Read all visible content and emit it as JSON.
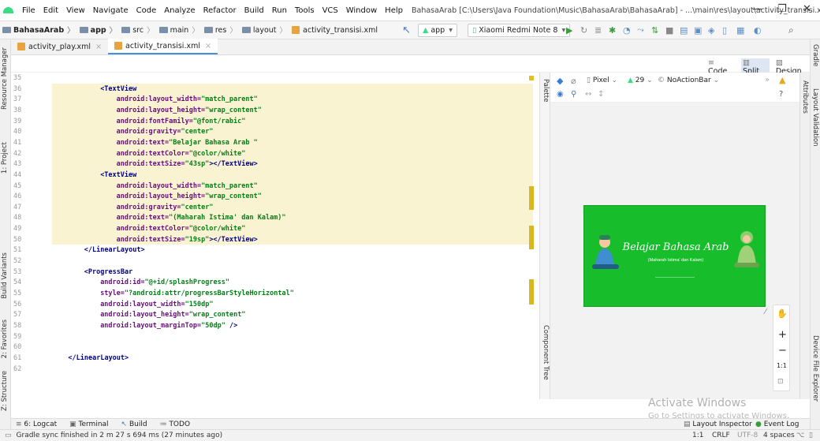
{
  "menu": {
    "items": [
      "File",
      "Edit",
      "View",
      "Navigate",
      "Code",
      "Analyze",
      "Refactor",
      "Build",
      "Run",
      "Tools",
      "VCS",
      "Window",
      "Help"
    ],
    "window_title": "BahasaArab [C:\\Users\\Java Foundation\\Music\\BahasaArab\\BahasaArab] - ...\\main\\res\\layout\\activity_transisi.xml [app]"
  },
  "nav": {
    "breadcrumbs": [
      "BahasaArab",
      "app",
      "src",
      "main",
      "res",
      "layout",
      "activity_transisi.xml"
    ],
    "module": "app",
    "device": "Xiaomi Redmi Note 8"
  },
  "tabs": [
    {
      "label": "activity_play.xml",
      "active": false
    },
    {
      "label": "activity_transisi.xml",
      "active": true
    }
  ],
  "view_modes": {
    "code": "Code",
    "split": "Split",
    "design": "Design"
  },
  "design_toolbar": {
    "device": "Pixel",
    "api": "29",
    "theme": "NoActionBar"
  },
  "left_tools": [
    "Resource Manager",
    "1: Project",
    "Build Variants",
    "2: Favorites",
    "Z: Structure"
  ],
  "right_tools": [
    "Gradle",
    "Layout Validation",
    "Device File Explorer"
  ],
  "attributes_label": "Attributes",
  "palette_label": "Palette",
  "component_tree_label": "Component Tree",
  "line_numbers": [
    "35",
    "36",
    "37",
    "38",
    "39",
    "40",
    "41",
    "42",
    "43",
    "44",
    "45",
    "46",
    "47",
    "48",
    "49",
    "50",
    "51",
    "52",
    "53",
    "54",
    "55",
    "56",
    "57",
    "58",
    "59",
    "60",
    "61",
    "62"
  ],
  "code": [
    {
      "parts": []
    },
    {
      "parts": [
        [
          "tag",
          "<TextView"
        ]
      ]
    },
    {
      "parts": [
        [
          "attr",
          "android:layout_width="
        ],
        [
          "val",
          "\"match_parent\""
        ]
      ]
    },
    {
      "parts": [
        [
          "attr",
          "android:layout_height="
        ],
        [
          "val",
          "\"wrap_content\""
        ]
      ]
    },
    {
      "parts": [
        [
          "attr",
          "android:fontFamily="
        ],
        [
          "val",
          "\"@font/rabic\""
        ]
      ]
    },
    {
      "parts": [
        [
          "attr",
          "android:gravity="
        ],
        [
          "val",
          "\"center\""
        ]
      ]
    },
    {
      "parts": [
        [
          "attr",
          "android:text="
        ],
        [
          "val",
          "\"Belajar Bahasa Arab \""
        ]
      ]
    },
    {
      "parts": [
        [
          "attr",
          "android:textColor="
        ],
        [
          "val",
          "\"@color/white\""
        ]
      ]
    },
    {
      "parts": [
        [
          "attr",
          "android:textSize="
        ],
        [
          "val",
          "\"43sp\""
        ],
        [
          "tag",
          "></TextView>"
        ]
      ]
    },
    {
      "parts": [
        [
          "tag",
          "<TextView"
        ]
      ]
    },
    {
      "parts": [
        [
          "attr",
          "android:layout_width="
        ],
        [
          "val",
          "\"match_parent\""
        ]
      ]
    },
    {
      "parts": [
        [
          "attr",
          "android:layout_height="
        ],
        [
          "val",
          "\"wrap_content\""
        ]
      ]
    },
    {
      "parts": [
        [
          "attr",
          "android:gravity="
        ],
        [
          "val",
          "\"center\""
        ]
      ]
    },
    {
      "parts": [
        [
          "attr",
          "android:text="
        ],
        [
          "val",
          "\"(Maharah Istima' dan Kalam)\""
        ]
      ]
    },
    {
      "parts": [
        [
          "attr",
          "android:textColor="
        ],
        [
          "val",
          "\"@color/white\""
        ]
      ]
    },
    {
      "parts": [
        [
          "attr",
          "android:textSize="
        ],
        [
          "val",
          "\"19sp\""
        ],
        [
          "tag",
          "></TextView>"
        ]
      ]
    },
    {
      "parts": [
        [
          "tag",
          "</LinearLayout>"
        ]
      ]
    },
    {
      "parts": []
    },
    {
      "parts": [
        [
          "tag",
          "<ProgressBar"
        ]
      ]
    },
    {
      "parts": [
        [
          "attr",
          "android:id="
        ],
        [
          "val",
          "\"@+id/splashProgress\""
        ]
      ]
    },
    {
      "parts": [
        [
          "attr",
          "style="
        ],
        [
          "val",
          "\"?android:attr/progressBarStyleHorizontal\""
        ]
      ]
    },
    {
      "parts": [
        [
          "attr",
          "android:layout_width="
        ],
        [
          "val",
          "\"150dp\""
        ]
      ]
    },
    {
      "parts": [
        [
          "attr",
          "android:layout_height="
        ],
        [
          "val",
          "\"wrap_content\""
        ]
      ]
    },
    {
      "parts": [
        [
          "attr",
          "android:layout_marginTop="
        ],
        [
          "val",
          "\"50dp\""
        ],
        [
          "tag",
          " />"
        ]
      ]
    },
    {
      "parts": []
    },
    {
      "parts": []
    },
    {
      "parts": [
        [
          "tag",
          "</LinearLayout>"
        ]
      ]
    },
    {
      "parts": []
    }
  ],
  "preview": {
    "title": "Belajar Bahasa Arab",
    "subtitle": "(Maharah Istima' dan Kalam)",
    "bg": "#17bd2b"
  },
  "zoom": {
    "plus": "+",
    "minus": "−",
    "ratio": "1:1"
  },
  "watermark": {
    "line1": "Activate Windows",
    "line2": "Go to Settings to activate Windows."
  },
  "bottom_tools": [
    "6: Logcat",
    "Terminal",
    "Build",
    "TODO"
  ],
  "bottom_right": [
    "Layout Inspector",
    "Event Log"
  ],
  "status": {
    "message": "Gradle sync finished in 2 m 27 s 694 ms (27 minutes ago)",
    "pos": "1:1",
    "line_sep": "CRLF",
    "encoding": "UTF-8",
    "indent": "4 spaces"
  }
}
